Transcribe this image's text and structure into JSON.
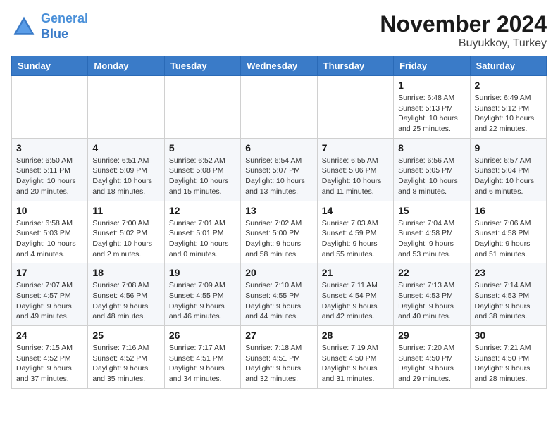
{
  "header": {
    "logo_line1": "General",
    "logo_line2": "Blue",
    "month_title": "November 2024",
    "location": "Buyukkoy, Turkey"
  },
  "weekdays": [
    "Sunday",
    "Monday",
    "Tuesday",
    "Wednesday",
    "Thursday",
    "Friday",
    "Saturday"
  ],
  "weeks": [
    [
      {
        "day": "",
        "info": ""
      },
      {
        "day": "",
        "info": ""
      },
      {
        "day": "",
        "info": ""
      },
      {
        "day": "",
        "info": ""
      },
      {
        "day": "",
        "info": ""
      },
      {
        "day": "1",
        "info": "Sunrise: 6:48 AM\nSunset: 5:13 PM\nDaylight: 10 hours and 25 minutes."
      },
      {
        "day": "2",
        "info": "Sunrise: 6:49 AM\nSunset: 5:12 PM\nDaylight: 10 hours and 22 minutes."
      }
    ],
    [
      {
        "day": "3",
        "info": "Sunrise: 6:50 AM\nSunset: 5:11 PM\nDaylight: 10 hours and 20 minutes."
      },
      {
        "day": "4",
        "info": "Sunrise: 6:51 AM\nSunset: 5:09 PM\nDaylight: 10 hours and 18 minutes."
      },
      {
        "day": "5",
        "info": "Sunrise: 6:52 AM\nSunset: 5:08 PM\nDaylight: 10 hours and 15 minutes."
      },
      {
        "day": "6",
        "info": "Sunrise: 6:54 AM\nSunset: 5:07 PM\nDaylight: 10 hours and 13 minutes."
      },
      {
        "day": "7",
        "info": "Sunrise: 6:55 AM\nSunset: 5:06 PM\nDaylight: 10 hours and 11 minutes."
      },
      {
        "day": "8",
        "info": "Sunrise: 6:56 AM\nSunset: 5:05 PM\nDaylight: 10 hours and 8 minutes."
      },
      {
        "day": "9",
        "info": "Sunrise: 6:57 AM\nSunset: 5:04 PM\nDaylight: 10 hours and 6 minutes."
      }
    ],
    [
      {
        "day": "10",
        "info": "Sunrise: 6:58 AM\nSunset: 5:03 PM\nDaylight: 10 hours and 4 minutes."
      },
      {
        "day": "11",
        "info": "Sunrise: 7:00 AM\nSunset: 5:02 PM\nDaylight: 10 hours and 2 minutes."
      },
      {
        "day": "12",
        "info": "Sunrise: 7:01 AM\nSunset: 5:01 PM\nDaylight: 10 hours and 0 minutes."
      },
      {
        "day": "13",
        "info": "Sunrise: 7:02 AM\nSunset: 5:00 PM\nDaylight: 9 hours and 58 minutes."
      },
      {
        "day": "14",
        "info": "Sunrise: 7:03 AM\nSunset: 4:59 PM\nDaylight: 9 hours and 55 minutes."
      },
      {
        "day": "15",
        "info": "Sunrise: 7:04 AM\nSunset: 4:58 PM\nDaylight: 9 hours and 53 minutes."
      },
      {
        "day": "16",
        "info": "Sunrise: 7:06 AM\nSunset: 4:58 PM\nDaylight: 9 hours and 51 minutes."
      }
    ],
    [
      {
        "day": "17",
        "info": "Sunrise: 7:07 AM\nSunset: 4:57 PM\nDaylight: 9 hours and 49 minutes."
      },
      {
        "day": "18",
        "info": "Sunrise: 7:08 AM\nSunset: 4:56 PM\nDaylight: 9 hours and 48 minutes."
      },
      {
        "day": "19",
        "info": "Sunrise: 7:09 AM\nSunset: 4:55 PM\nDaylight: 9 hours and 46 minutes."
      },
      {
        "day": "20",
        "info": "Sunrise: 7:10 AM\nSunset: 4:55 PM\nDaylight: 9 hours and 44 minutes."
      },
      {
        "day": "21",
        "info": "Sunrise: 7:11 AM\nSunset: 4:54 PM\nDaylight: 9 hours and 42 minutes."
      },
      {
        "day": "22",
        "info": "Sunrise: 7:13 AM\nSunset: 4:53 PM\nDaylight: 9 hours and 40 minutes."
      },
      {
        "day": "23",
        "info": "Sunrise: 7:14 AM\nSunset: 4:53 PM\nDaylight: 9 hours and 38 minutes."
      }
    ],
    [
      {
        "day": "24",
        "info": "Sunrise: 7:15 AM\nSunset: 4:52 PM\nDaylight: 9 hours and 37 minutes."
      },
      {
        "day": "25",
        "info": "Sunrise: 7:16 AM\nSunset: 4:52 PM\nDaylight: 9 hours and 35 minutes."
      },
      {
        "day": "26",
        "info": "Sunrise: 7:17 AM\nSunset: 4:51 PM\nDaylight: 9 hours and 34 minutes."
      },
      {
        "day": "27",
        "info": "Sunrise: 7:18 AM\nSunset: 4:51 PM\nDaylight: 9 hours and 32 minutes."
      },
      {
        "day": "28",
        "info": "Sunrise: 7:19 AM\nSunset: 4:50 PM\nDaylight: 9 hours and 31 minutes."
      },
      {
        "day": "29",
        "info": "Sunrise: 7:20 AM\nSunset: 4:50 PM\nDaylight: 9 hours and 29 minutes."
      },
      {
        "day": "30",
        "info": "Sunrise: 7:21 AM\nSunset: 4:50 PM\nDaylight: 9 hours and 28 minutes."
      }
    ]
  ]
}
